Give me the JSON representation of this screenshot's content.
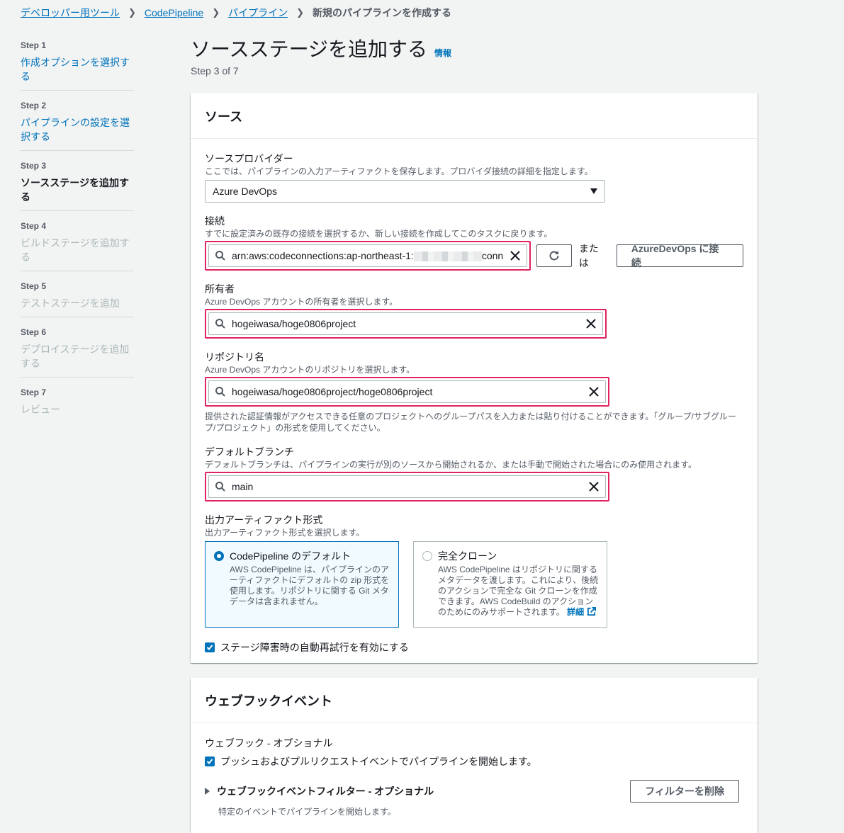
{
  "breadcrumb": {
    "items": [
      "デベロッパー用ツール",
      "CodePipeline",
      "パイプライン"
    ],
    "current": "新規のパイプラインを作成する"
  },
  "steps": [
    {
      "num": "Step 1",
      "label": "作成オプションを選択する",
      "state": "link"
    },
    {
      "num": "Step 2",
      "label": "パイプラインの設定を選択する",
      "state": "link"
    },
    {
      "num": "Step 3",
      "label": "ソースステージを追加する",
      "state": "active"
    },
    {
      "num": "Step 4",
      "label": "ビルドステージを追加する",
      "state": "disabled"
    },
    {
      "num": "Step 5",
      "label": "テストステージを追加",
      "state": "disabled"
    },
    {
      "num": "Step 6",
      "label": "デプロイステージを追加する",
      "state": "disabled"
    },
    {
      "num": "Step 7",
      "label": "レビュー",
      "state": "disabled"
    }
  ],
  "page": {
    "title": "ソースステージを追加する",
    "info": "情報",
    "step_indicator": "Step 3 of 7"
  },
  "source": {
    "header": "ソース",
    "provider": {
      "label": "ソースプロバイダー",
      "desc": "ここでは、パイプラインの入力アーティファクトを保存します。プロバイダ接続の詳細を指定します。",
      "value": "Azure DevOps"
    },
    "connection": {
      "label": "接続",
      "desc": "すでに設定済みの既存の接続を選択するか、新しい接続を作成してこのタスクに戻ります。",
      "value_prefix": "arn:aws:codeconnections:ap-northeast-1:",
      "value_suffix": "conn",
      "or": "または",
      "connect_button": "AzureDevOps に接続"
    },
    "owner": {
      "label": "所有者",
      "desc": "Azure DevOps アカウントの所有者を選択します。",
      "value": "hogeiwasa/hoge0806project"
    },
    "repo": {
      "label": "リポジトリ名",
      "desc": "Azure DevOps アカウントのリポジトリを選択します。",
      "value": "hogeiwasa/hoge0806project/hoge0806project",
      "hint": "提供された認証情報がアクセスできる任意のプロジェクトへのグループパスを入力または貼り付けることができます。「グループ/サブグループ/プロジェクト」の形式を使用してください。"
    },
    "branch": {
      "label": "デフォルトブランチ",
      "desc": "デフォルトブランチは、パイプラインの実行が別のソースから開始されるか、または手動で開始された場合にのみ使用されます。",
      "value": "main"
    },
    "artifact": {
      "label": "出力アーティファクト形式",
      "desc": "出力アーティファクト形式を選択します。",
      "options": [
        {
          "title": "CodePipeline のデフォルト",
          "desc": "AWS CodePipeline は、パイプラインのアーティファクトにデフォルトの zip 形式を使用します。リポジトリに関する Git メタデータは含まれません。",
          "selected": true
        },
        {
          "title": "完全クローン",
          "desc": "AWS CodePipeline はリポジトリに関するメタデータを渡します。これにより、後続のアクションで完全な Git クローンを作成できます。AWS CodeBuild のアクションのためにのみサポートされます。",
          "link": "詳細",
          "selected": false
        }
      ]
    },
    "retry_label": "ステージ障害時の自動再試行を有効にする"
  },
  "webhook": {
    "header": "ウェブフックイベント",
    "label": "ウェブフック - オプショナル",
    "check_label": "プッシュおよびプルリクエストイベントでパイプラインを開始します。",
    "filter_title": "ウェブフックイベントフィルター - オプショナル",
    "filter_desc": "特定のイベントでパイプラインを開始します。",
    "remove_button": "フィルターを削除"
  },
  "colors": {
    "link": "#0073bb",
    "highlight": "#e0245e",
    "background": "#f2f3f3"
  }
}
